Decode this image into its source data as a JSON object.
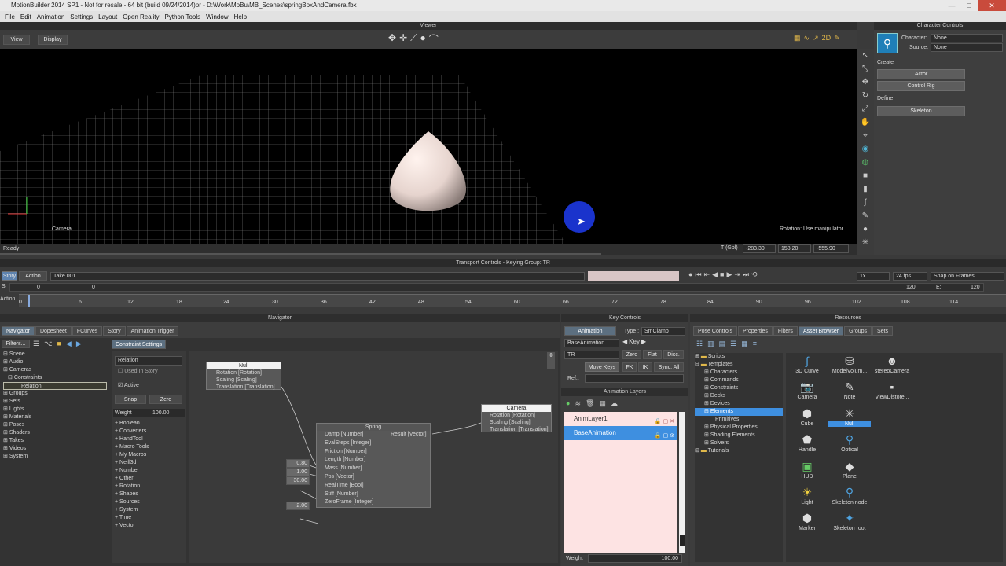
{
  "window": {
    "title": "MotionBuilder 2014 SP1 - Not for resale - 64 bit (build 09/24/2014)pr - D:\\Work\\MoBu\\MB_Scenes\\springBoxAndCamera.fbx",
    "min": "—",
    "max": "□",
    "close": "✕"
  },
  "menu": [
    "File",
    "Edit",
    "Animation",
    "Settings",
    "Layout",
    "Open Reality",
    "Python Tools",
    "Window",
    "Help"
  ],
  "viewer": {
    "title": "Viewer",
    "view_btn": "View",
    "display_btn": "Display",
    "camera_label": "Camera",
    "status_hint": "Rotation: Use manipulator",
    "ready": "Ready",
    "tgbl_label": "T (Gbl)",
    "tx": "-283.30",
    "ty": "158.20",
    "tz": "-555.90"
  },
  "character_controls": {
    "title": "Character Controls",
    "character_label": "Character:",
    "character_value": "None",
    "source_label": "Source:",
    "source_value": "None",
    "create_label": "Create",
    "actor_btn": "Actor",
    "control_rig_btn": "Control Rig",
    "define_label": "Define",
    "skeleton_btn": "Skeleton"
  },
  "transport": {
    "title": "Transport Controls - Keying Group: TR",
    "story_btn": "Story",
    "action_btn": "Action",
    "take": "Take 001",
    "speed": "1x",
    "fps": "24 fps",
    "snap": "Snap on Frames",
    "s_label": "S:",
    "s_value": "0",
    "start": "0",
    "end_value": "120",
    "e_label": "E:",
    "e_value": "120",
    "action_label": "Action",
    "ticks": [
      "0",
      "6",
      "12",
      "18",
      "24",
      "30",
      "36",
      "42",
      "48",
      "54",
      "60",
      "66",
      "72",
      "78",
      "84",
      "90",
      "96",
      "102",
      "108",
      "114"
    ]
  },
  "navigator": {
    "title": "Navigator",
    "tabs": [
      "Navigator",
      "Dopesheet",
      "FCurves",
      "Story",
      "Animation Trigger"
    ],
    "filters_label": "Filters...",
    "constraint_settings_tab": "Constraint Settings",
    "tree": [
      "Scene",
      "Audio",
      "Cameras",
      "Constraints",
      "Relation",
      "Groups",
      "Sets",
      "Lights",
      "Materials",
      "Poses",
      "Shaders",
      "Takes",
      "Videos",
      "System"
    ],
    "relation_field": "Relation",
    "used_in_story": "Used In Story",
    "active": "Active",
    "snap_btn": "Snap",
    "zero_btn": "Zero",
    "weight_label": "Weight",
    "weight_value": "100.00",
    "operators": [
      "Boolean",
      "Converters",
      "HandTool",
      "Macro Tools",
      "My Macros",
      "Neill3d",
      "Number",
      "Other",
      "Rotation",
      "Shapes",
      "Sources",
      "System",
      "Time",
      "Vector"
    ]
  },
  "relation_graph": {
    "null_node": {
      "title": "Null",
      "rows": [
        "Rotation [Rotation]",
        "Scaling [Scaling]",
        "Translation [Translation]"
      ]
    },
    "camera_node": {
      "title": "Camera",
      "rows": [
        "Rotation [Rotation]",
        "Scaling [Scaling]",
        "Translation [Translation]"
      ]
    },
    "spring_node": {
      "title": "Spring",
      "result": "Result [Vector]",
      "rows": [
        "Damp [Number]",
        "EvalSteps [Integer]",
        "Friction [Number]",
        "Length [Number]",
        "Mass [Number]",
        "Pos [Vector]",
        "RealTime [Bool]",
        "Stiff [Number]",
        "ZeroFrame [Integer]"
      ]
    },
    "inputs": [
      "0.80",
      "1.00",
      "30.00",
      "2.00"
    ]
  },
  "key_controls": {
    "title": "Key Controls",
    "animation_tab": "Animation",
    "type_label": "Type :",
    "type_value": "SmClamp",
    "layer_value": "BaseAnimation",
    "key_label": "Key",
    "group_value": "TR",
    "zero_btn": "Zero",
    "flat_btn": "Flat",
    "disc_btn": "Disc.",
    "move_keys_btn": "Move Keys",
    "fk_btn": "FK",
    "ik_btn": "IK",
    "sync_all_btn": "Sync. All",
    "ref_label": "Ref.:",
    "animation_layers_title": "Animation Layers",
    "layers": [
      "AnimLayer1",
      "BaseAnimation"
    ],
    "weight_label": "Weight",
    "weight_value": "100.00"
  },
  "resources": {
    "title": "Resources",
    "tabs": [
      "Pose Controls",
      "Properties",
      "Filters",
      "Asset Browser",
      "Groups",
      "Sets"
    ],
    "tree": [
      "Scripts",
      "Templates",
      "Characters",
      "Commands",
      "Constraints",
      "Decks",
      "Devices",
      "Elements",
      "Primitives",
      "Physical Properties",
      "Shading Elements",
      "Solvers",
      "Tutorials"
    ],
    "assets": [
      {
        "label": "3D Curve",
        "icon": "curve-icon"
      },
      {
        "label": "ModelVolum...",
        "icon": "volume-icon"
      },
      {
        "label": "stereoCamera",
        "icon": "stereo-camera-icon"
      },
      {
        "label": "Camera",
        "icon": "camera-icon"
      },
      {
        "label": "Note",
        "icon": "note-icon"
      },
      {
        "label": "ViewDistore...",
        "icon": "view-icon"
      },
      {
        "label": "Cube",
        "icon": "cube-icon"
      },
      {
        "label": "Null",
        "icon": "null-icon"
      },
      {
        "label": "",
        "icon": ""
      },
      {
        "label": "Handle",
        "icon": "handle-icon"
      },
      {
        "label": "Optical",
        "icon": "optical-icon"
      },
      {
        "label": "",
        "icon": ""
      },
      {
        "label": "HUD",
        "icon": "hud-icon"
      },
      {
        "label": "Plane",
        "icon": "plane-icon"
      },
      {
        "label": "",
        "icon": ""
      },
      {
        "label": "Light",
        "icon": "light-icon"
      },
      {
        "label": "Skeleton node",
        "icon": "skeleton-node-icon"
      },
      {
        "label": "",
        "icon": ""
      },
      {
        "label": "Marker",
        "icon": "marker-icon"
      },
      {
        "label": "Skeleton root",
        "icon": "skeleton-root-icon"
      },
      {
        "label": "",
        "icon": ""
      }
    ]
  }
}
